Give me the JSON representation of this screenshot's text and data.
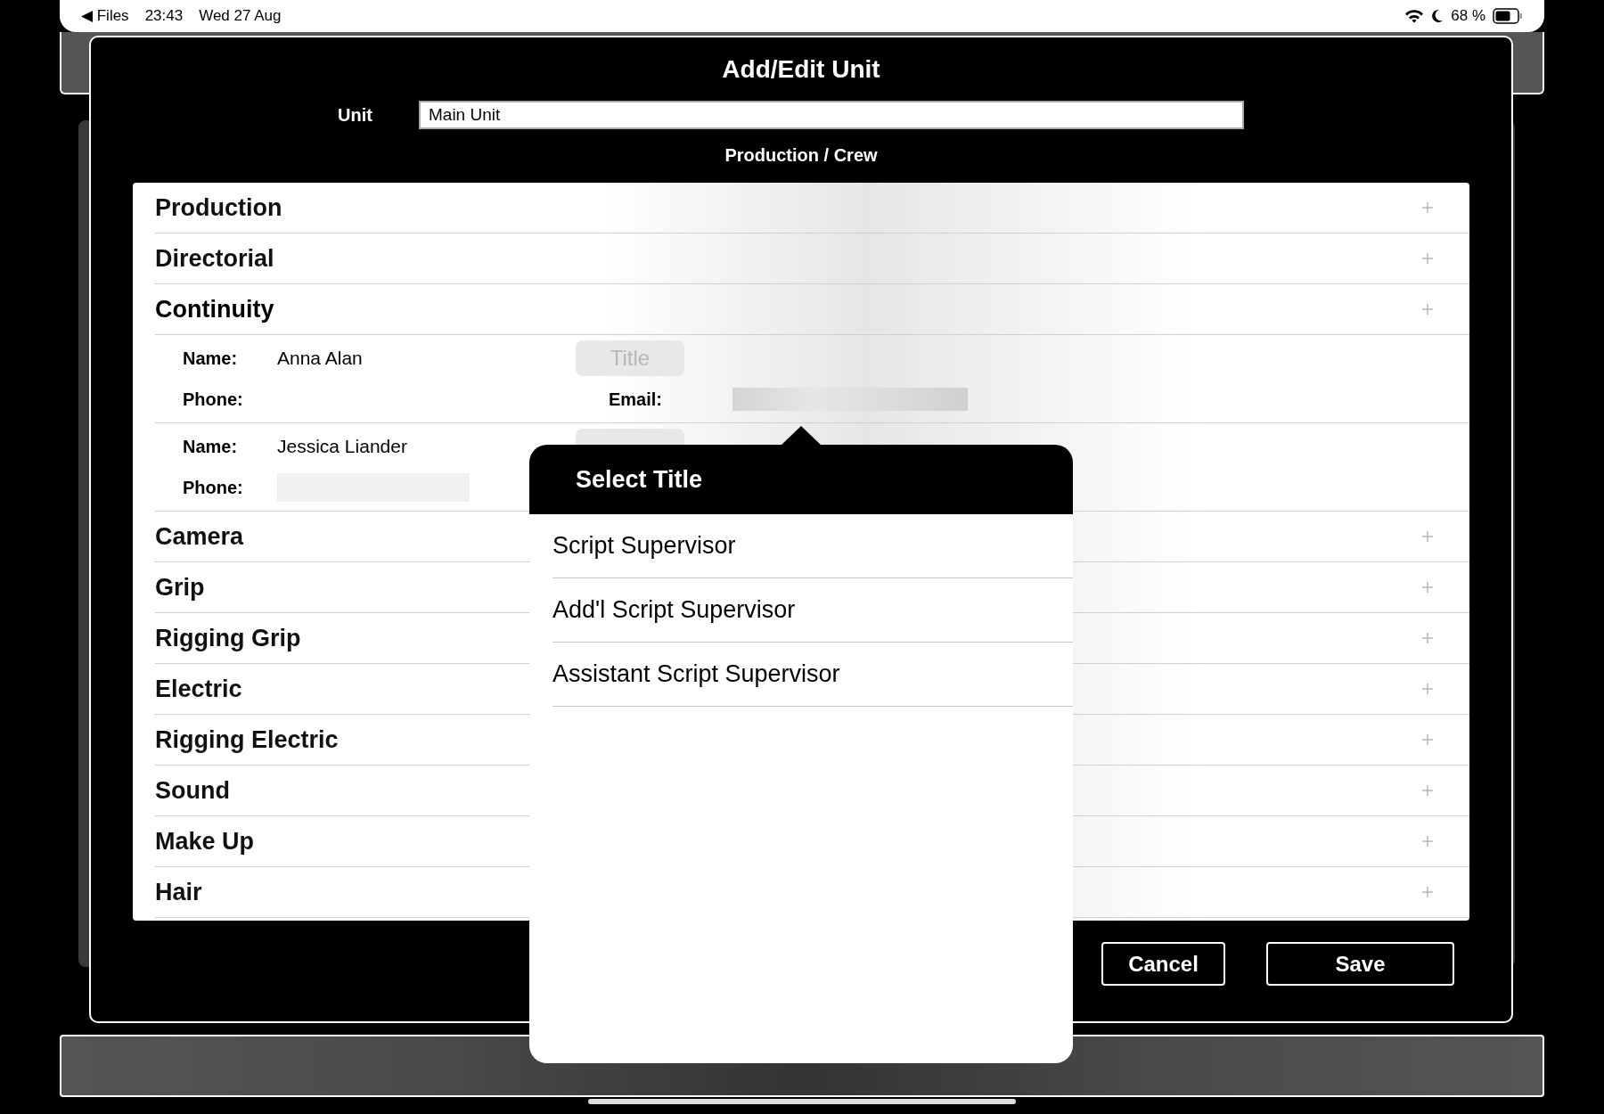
{
  "status_bar": {
    "back": "◀ Files",
    "time": "23:43",
    "date": "Wed 27 Aug",
    "battery": "68 %"
  },
  "window": {
    "title": "Add/Edit Unit"
  },
  "unit": {
    "label": "Unit",
    "value": "Main Unit"
  },
  "section_heading": "Production / Crew",
  "sections": [
    {
      "name": "Production",
      "expanded": false
    },
    {
      "name": "Directorial",
      "expanded": false
    },
    {
      "name": "Continuity",
      "expanded": true,
      "contacts": [
        {
          "name_label": "Name:",
          "name": "Anna Alan",
          "title_button": "Title",
          "phone_label": "Phone:",
          "email_label": "Email:"
        },
        {
          "name_label": "Name:",
          "name": "Jessica Liander",
          "phone_label": "Phone:"
        }
      ]
    },
    {
      "name": "Camera",
      "expanded": false
    },
    {
      "name": "Grip",
      "expanded": false
    },
    {
      "name": "Rigging Grip",
      "expanded": false
    },
    {
      "name": "Electric",
      "expanded": false
    },
    {
      "name": "Rigging Electric",
      "expanded": false
    },
    {
      "name": "Sound",
      "expanded": false
    },
    {
      "name": "Make Up",
      "expanded": false
    },
    {
      "name": "Hair",
      "expanded": false
    }
  ],
  "buttons": [
    "Cancel",
    "Save"
  ],
  "popover": {
    "title": "Select Title",
    "options": [
      "Script Supervisor",
      "Add'l Script Supervisor",
      "Assistant Script Supervisor"
    ]
  }
}
